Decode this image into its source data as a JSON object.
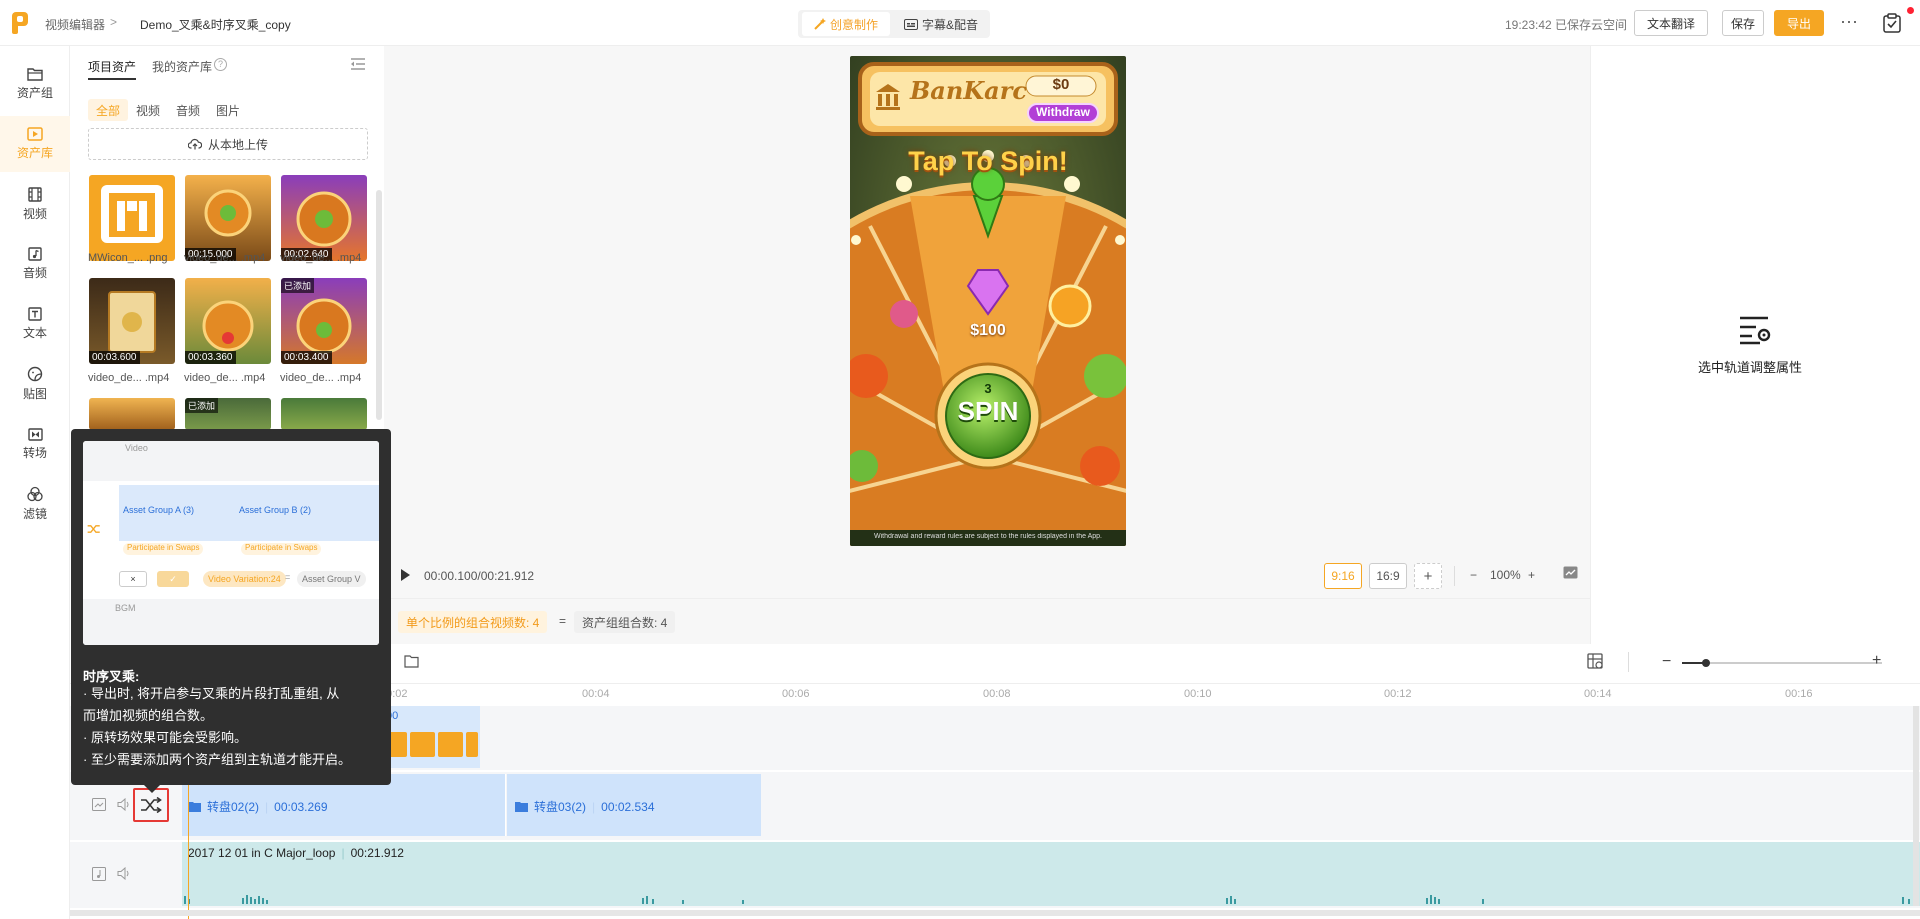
{
  "header": {
    "breadcrumb_root": "视频编辑器",
    "breadcrumb_sep": ">",
    "project_name": "Demo_叉乘&时序叉乘_copy",
    "mode_creative": "创意制作",
    "mode_subtitle": "字幕&配音",
    "save_status": "19:23:42 已保存云空间",
    "translate_label": "文本翻译",
    "save_label": "保存",
    "export_label": "导出",
    "more_label": "···"
  },
  "rail": [
    {
      "label": "资产组",
      "icon": "folder-icon"
    },
    {
      "label": "资产库",
      "icon": "asset-library-icon",
      "active": true
    },
    {
      "label": "视频",
      "icon": "film-icon"
    },
    {
      "label": "音频",
      "icon": "music-icon"
    },
    {
      "label": "文本",
      "icon": "text-icon"
    },
    {
      "label": "贴图",
      "icon": "sticker-icon"
    },
    {
      "label": "转场",
      "icon": "transition-icon"
    },
    {
      "label": "滤镜",
      "icon": "filter-icon"
    }
  ],
  "assets": {
    "tab_project": "项目资产",
    "tab_mine": "我的资产库",
    "help": "?",
    "filters": [
      "全部",
      "视频",
      "音频",
      "图片"
    ],
    "active_filter": "全部",
    "upload_label": "从本地上传",
    "items": [
      {
        "name": "MWicon_... .png",
        "duration": "",
        "tag": ""
      },
      {
        "name": "video_de... .mp4",
        "duration": "00:15.000",
        "tag": ""
      },
      {
        "name": "video_de... .mp4",
        "duration": "00:02.640",
        "tag": ""
      },
      {
        "name": "video_de... .mp4",
        "duration": "00:03.600",
        "tag": ""
      },
      {
        "name": "video_de... .mp4",
        "duration": "00:03.360",
        "tag": ""
      },
      {
        "name": "video_de... .mp4",
        "duration": "00:03.400",
        "tag": "已添加"
      },
      {
        "name": "",
        "duration": "",
        "tag": ""
      },
      {
        "name": "",
        "duration": "",
        "tag": "已添加"
      },
      {
        "name": "",
        "duration": "",
        "tag": ""
      }
    ]
  },
  "preview": {
    "game_brand": "BanKarc",
    "balance": "$0",
    "withdraw": "Withdraw",
    "headline": "Tap To Spin!",
    "prize_center": "$100",
    "spin_count": "3",
    "spin_label": "SPIN",
    "disclaimer": "Withdrawal and reward rules are subject to the rules displayed in the App.",
    "timecode": "00:00.100/00:21.912",
    "ratio_916": "9:16",
    "ratio_169": "16:9",
    "ratio_add": "+",
    "zoom_minus": "−",
    "zoom_value": "100%",
    "zoom_plus": "+"
  },
  "properties": {
    "hint": "选中轨道调整属性"
  },
  "combo": {
    "single_ratio": "单个比例的组合视频数:  4",
    "eq": "=",
    "group_combos": "资产组组合数:  4"
  },
  "timeline": {
    "ruler": [
      "00:02",
      "00:04",
      "00:06",
      "00:08",
      "00:10",
      "00:12",
      "00:14",
      "00:16"
    ],
    "video_clip_time": "00",
    "group_clips": [
      {
        "name": "转盘02(2)",
        "duration": "00:03.269"
      },
      {
        "name": "转盘03(2)",
        "duration": "00:02.534"
      }
    ],
    "audio_name": "2017 12 01 in C Major_loop",
    "audio_duration": "00:21.912"
  },
  "tooltip": {
    "img_track_video": "Video",
    "img_group_a": "Asset Group A (3)",
    "img_group_b": "Asset Group B (2)",
    "img_participate": "Participate in Swaps",
    "img_close": "×",
    "img_check": "✓",
    "img_variation": "Video Variation:24",
    "img_eq": "=",
    "img_group_v": "Asset Group V",
    "img_bgm": "BGM",
    "title": "时序叉乘:",
    "lines": [
      "· 导出时, 将开启参与叉乘的片段打乱重组, 从",
      "而增加视频的组合数。",
      "· 原转场效果可能会受影响。",
      "· 至少需要添加两个资产组到主轨道才能开启。"
    ]
  },
  "colors": {
    "accent": "#f5a623",
    "clip_blue": "#cfe3fb",
    "audio_teal": "#cde9ea",
    "highlight_red": "#e53935"
  }
}
